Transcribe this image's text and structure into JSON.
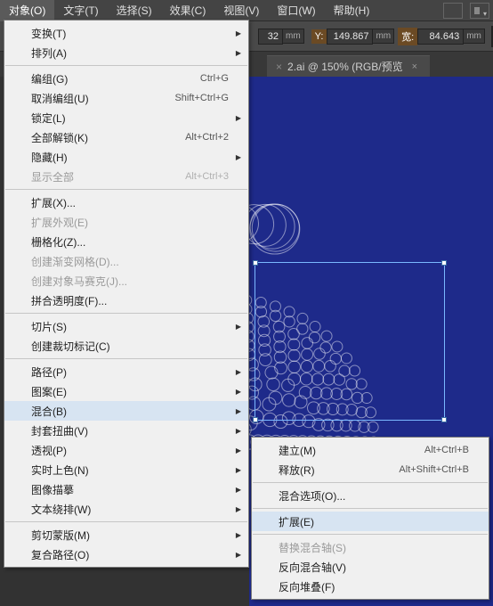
{
  "menubar": {
    "items": [
      "对象(O)",
      "文字(T)",
      "选择(S)",
      "效果(C)",
      "视图(V)",
      "窗口(W)",
      "帮助(H)"
    ]
  },
  "options": {
    "y_label": "Y:",
    "y_value": "149.867",
    "w_label": "宽:",
    "w_value": "84.643",
    "unit1": "mm",
    "unit2": "mm",
    "leading_value": "32",
    "leading_unit": "mm"
  },
  "tab": {
    "title": "2.ai @ 150% (RGB/预览"
  },
  "menu1": {
    "groups": [
      [
        {
          "label": "变换(T)",
          "sub": true
        },
        {
          "label": "排列(A)",
          "sub": true
        }
      ],
      [
        {
          "label": "编组(G)",
          "shortcut": "Ctrl+G"
        },
        {
          "label": "取消编组(U)",
          "shortcut": "Shift+Ctrl+G"
        },
        {
          "label": "锁定(L)",
          "sub": true
        },
        {
          "label": "全部解锁(K)",
          "shortcut": "Alt+Ctrl+2"
        },
        {
          "label": "隐藏(H)",
          "sub": true
        },
        {
          "label": "显示全部",
          "shortcut": "Alt+Ctrl+3",
          "disabled": true
        }
      ],
      [
        {
          "label": "扩展(X)..."
        },
        {
          "label": "扩展外观(E)",
          "disabled": true
        },
        {
          "label": "栅格化(Z)..."
        },
        {
          "label": "创建渐变网格(D)...",
          "disabled": true
        },
        {
          "label": "创建对象马赛克(J)...",
          "disabled": true
        },
        {
          "label": "拼合透明度(F)..."
        }
      ],
      [
        {
          "label": "切片(S)",
          "sub": true
        },
        {
          "label": "创建裁切标记(C)"
        }
      ],
      [
        {
          "label": "路径(P)",
          "sub": true
        },
        {
          "label": "图案(E)",
          "sub": true
        },
        {
          "label": "混合(B)",
          "sub": true,
          "highlight": true
        },
        {
          "label": "封套扭曲(V)",
          "sub": true
        },
        {
          "label": "透视(P)",
          "sub": true
        },
        {
          "label": "实时上色(N)",
          "sub": true
        },
        {
          "label": "图像描摹",
          "sub": true
        },
        {
          "label": "文本绕排(W)",
          "sub": true
        }
      ],
      [
        {
          "label": "剪切蒙版(M)",
          "sub": true
        },
        {
          "label": "复合路径(O)",
          "sub": true
        }
      ]
    ]
  },
  "menu2": {
    "groups": [
      [
        {
          "label": "建立(M)",
          "shortcut": "Alt+Ctrl+B"
        },
        {
          "label": "释放(R)",
          "shortcut": "Alt+Shift+Ctrl+B"
        }
      ],
      [
        {
          "label": "混合选项(O)..."
        }
      ],
      [
        {
          "label": "扩展(E)",
          "highlight": true
        }
      ],
      [
        {
          "label": "替换混合轴(S)",
          "disabled": true
        },
        {
          "label": "反向混合轴(V)"
        },
        {
          "label": "反向堆叠(F)"
        }
      ]
    ]
  }
}
